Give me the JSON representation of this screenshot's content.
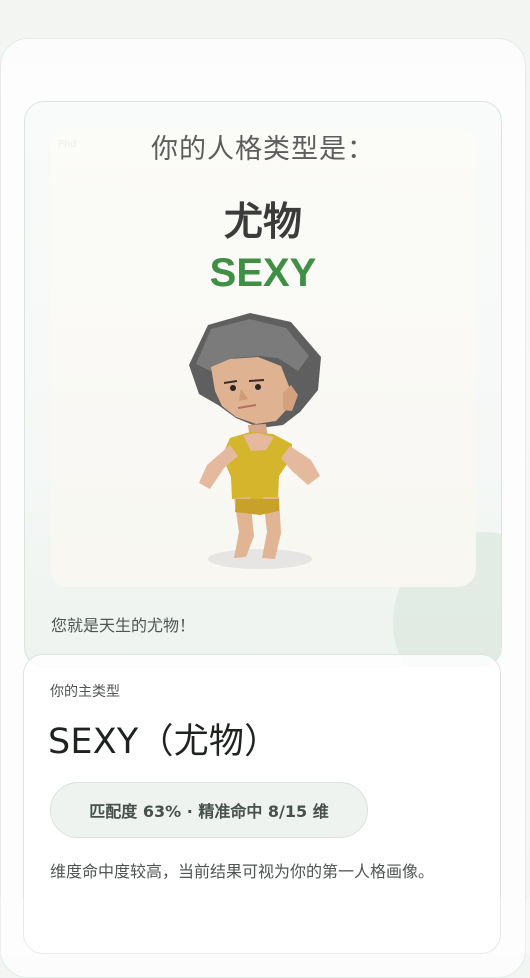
{
  "result_card": {
    "poster_tag": "Phd",
    "poster_title": "你的人格类型是：",
    "type_cn": "尤物",
    "type_en": "SEXY",
    "summary": "您就是天生的尤物！"
  },
  "main_type_card": {
    "label": "你的主类型",
    "title": "SEXY（尤物）",
    "match_text": "匹配度 63% · 精准命中 8/15 维",
    "match_percent": 63,
    "matched_dimensions": 8,
    "total_dimensions": 15,
    "description": "维度命中度较高，当前结果可视为你的第一人格画像。"
  },
  "colors": {
    "accent_green": "#3f8f45",
    "card_border": "#dde4df",
    "pill_background": "#eef3ef",
    "text_dark": "#1f2320"
  },
  "icons": {
    "result_illustration": "character-illustration"
  }
}
